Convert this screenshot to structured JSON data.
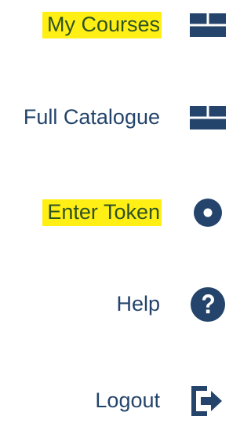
{
  "menu": {
    "items": [
      {
        "label": "My Courses",
        "icon": "grid-icon",
        "highlighted": true
      },
      {
        "label": "Full Catalogue",
        "icon": "grid-icon",
        "highlighted": false
      },
      {
        "label": "Enter Token",
        "icon": "dot-circle-icon",
        "highlighted": true
      },
      {
        "label": "Help",
        "icon": "question-circle-icon",
        "highlighted": false
      },
      {
        "label": "Logout",
        "icon": "sign-out-icon",
        "highlighted": false
      }
    ]
  },
  "colors": {
    "icon": "#24446b",
    "text": "#24446b",
    "highlight": "#ffef15",
    "highlighted_text": "#2f5222"
  }
}
